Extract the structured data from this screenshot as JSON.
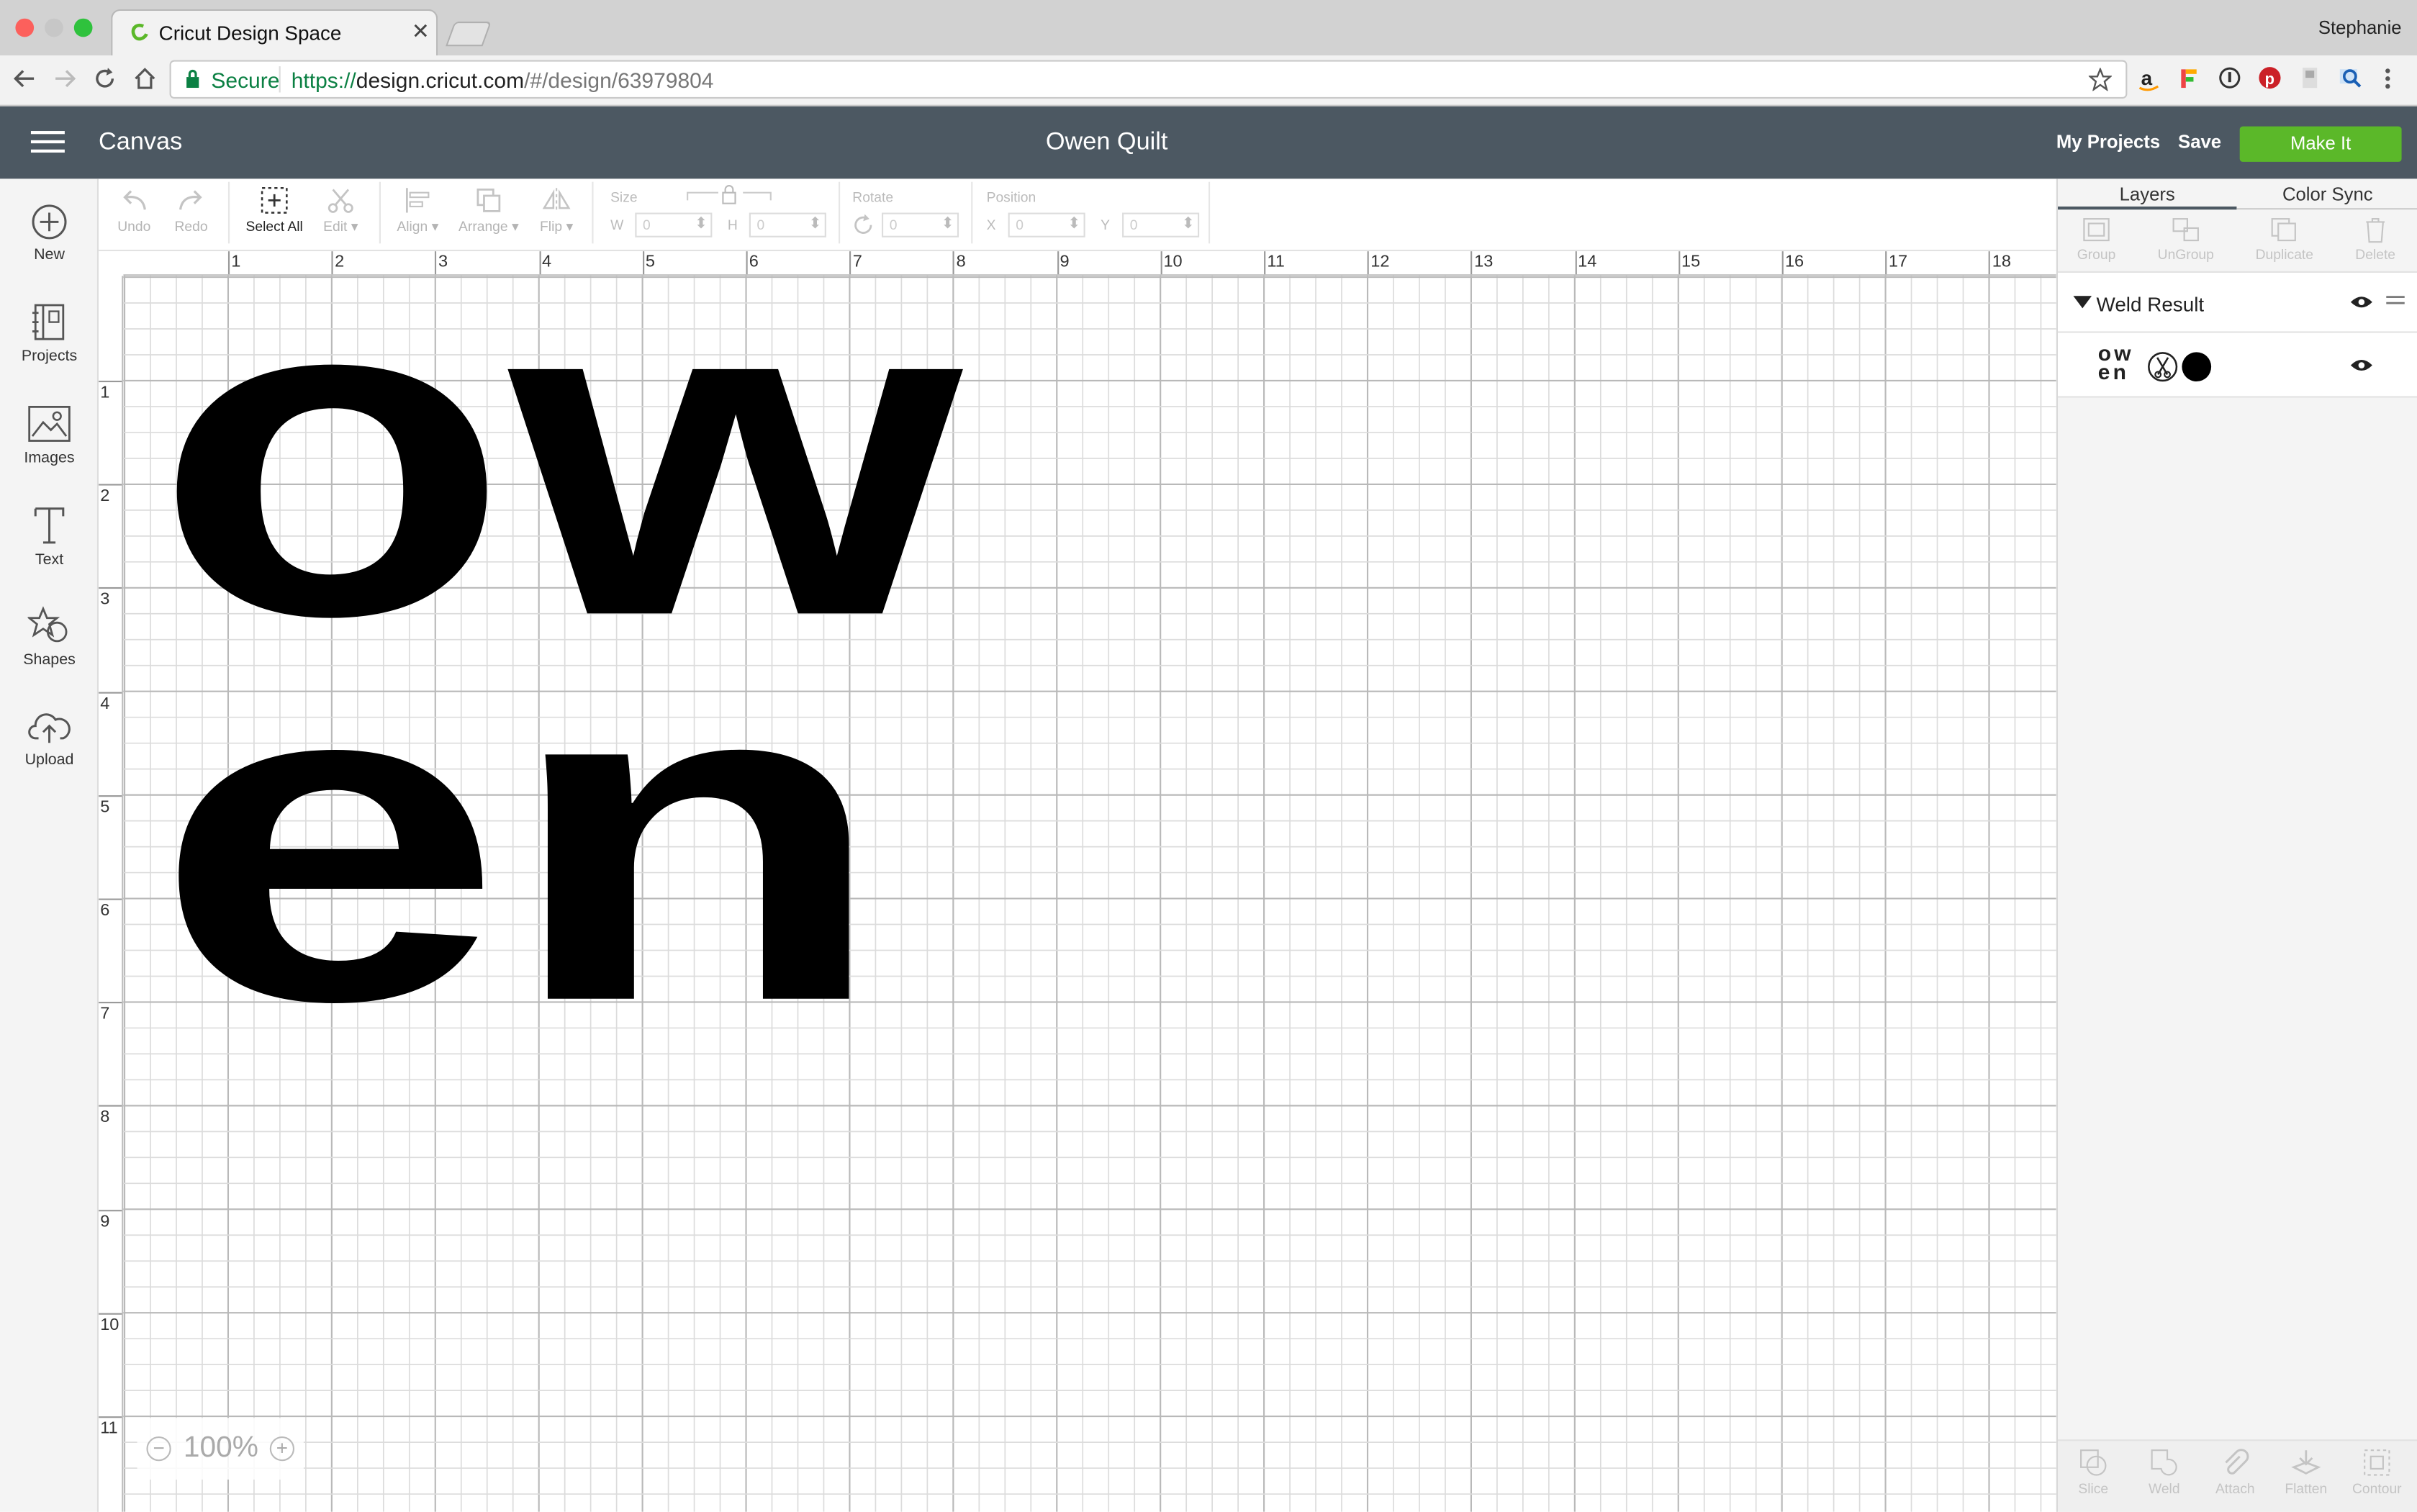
{
  "browser": {
    "tab_title": "Cricut Design Space",
    "profile_name": "Stephanie",
    "secure_label": "Secure",
    "url_protocol": "https://",
    "url_host": "design.cricut.com",
    "url_path": "/#/design/63979804"
  },
  "header": {
    "mode_label": "Canvas",
    "project_title": "Owen Quilt",
    "my_projects_label": "My Projects",
    "save_label": "Save",
    "make_it_label": "Make It",
    "make_it_color": "#5bb829",
    "bar_color": "#4c5862"
  },
  "sidebar": {
    "items": [
      {
        "label": "New",
        "icon": "plus-circle-icon"
      },
      {
        "label": "Projects",
        "icon": "projects-icon"
      },
      {
        "label": "Images",
        "icon": "images-icon"
      },
      {
        "label": "Text",
        "icon": "text-icon"
      },
      {
        "label": "Shapes",
        "icon": "shapes-icon"
      },
      {
        "label": "Upload",
        "icon": "upload-cloud-icon"
      }
    ]
  },
  "toolbar": {
    "undo_label": "Undo",
    "redo_label": "Redo",
    "select_all_label": "Select All",
    "edit_label": "Edit",
    "align_label": "Align",
    "arrange_label": "Arrange",
    "flip_label": "Flip",
    "size_label": "Size",
    "w_label": "W",
    "w_value": "0",
    "h_label": "H",
    "h_value": "0",
    "rotate_label": "Rotate",
    "rotate_value": "0",
    "position_label": "Position",
    "x_label": "X",
    "x_value": "0",
    "y_label": "Y",
    "y_value": "0"
  },
  "canvas": {
    "ruler_top": [
      "1",
      "2",
      "3",
      "4",
      "5",
      "6",
      "7",
      "8",
      "9",
      "10",
      "11",
      "12",
      "13",
      "14",
      "15",
      "16",
      "17",
      "18"
    ],
    "ruler_left": [
      "1",
      "2",
      "3",
      "4",
      "5",
      "6",
      "7",
      "8",
      "9",
      "10",
      "11"
    ],
    "design_text_line1": "ow",
    "design_text_line2": "en",
    "zoom_level": "100%"
  },
  "layers_panel": {
    "tab_layers": "Layers",
    "tab_color_sync": "Color Sync",
    "top_tools": [
      "Group",
      "UnGroup",
      "Duplicate",
      "Delete"
    ],
    "group_name": "Weld Result",
    "thumb_line1": "ow",
    "thumb_line2": "en",
    "bottom_tools": [
      "Slice",
      "Weld",
      "Attach",
      "Flatten",
      "Contour"
    ]
  }
}
